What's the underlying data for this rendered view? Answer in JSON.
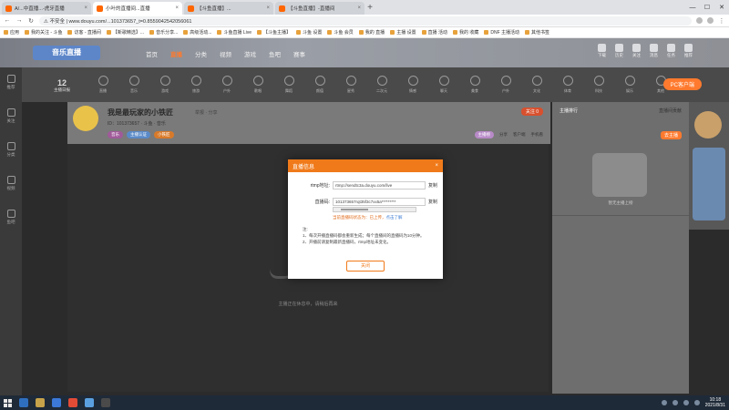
{
  "browser": {
    "tabs": [
      {
        "title": "A/...中直播...-虎牙直播",
        "active": false
      },
      {
        "title": "小叶的直播间...直播",
        "active": true
      },
      {
        "title": "【斗鱼直播】...",
        "active": false
      },
      {
        "title": "【斗鱼直播】-直播间",
        "active": false
      }
    ],
    "url": "⚠ 不安全 | www.douyu.com/...101373657_t=0.8559042542056061",
    "bookmarks": [
      "应用",
      "我的关注 - 斗鱼",
      "访客 - 直播间",
      "【新歌精选】...",
      "音乐分享...",
      "高级活动...",
      "斗鱼直播 Live",
      "【斗鱼主播】",
      "斗鱼 设置",
      "斗鱼 会员",
      "我的 直播",
      "主播 设置",
      "直播 活动",
      "我的 收藏",
      "DNF 主播活动",
      "其他书签"
    ]
  },
  "site": {
    "logo": "音乐直播",
    "nav": [
      {
        "label": "首页",
        "active": false
      },
      {
        "label": "直播",
        "active": true
      },
      {
        "label": "分类",
        "active": false
      },
      {
        "label": "视频",
        "active": false
      },
      {
        "label": "游戏",
        "active": false
      },
      {
        "label": "鱼吧",
        "active": false
      },
      {
        "label": "赛事",
        "active": false
      }
    ],
    "header_icons": [
      "下载",
      "历史",
      "关注",
      "消息",
      "任务",
      "推荐"
    ]
  },
  "sidebar": [
    "推荐",
    "关注",
    "分类",
    "视频",
    "鱼吧"
  ],
  "categories": {
    "day": "12",
    "day_label": "主播日报",
    "items": [
      "直播",
      "音乐",
      "游戏",
      "旅游",
      "户外",
      "歌唱",
      "舞蹈",
      "颜值",
      "星秀",
      "二次元",
      "情感",
      "聊天",
      "美食",
      "户外",
      "文化",
      "体育",
      "科技",
      "娱乐",
      "其他"
    ],
    "pc_button": "PC客户端"
  },
  "room": {
    "title": "我是最玩家的小铁匠",
    "tag": "举报 · 分享",
    "meta": "ID：101373657 · 斗鱼 · 音乐",
    "badges": [
      "音乐",
      "主播认证",
      "小铁匠"
    ],
    "follow": "关注 0",
    "actions": [
      "分享",
      "客户端",
      "手机看"
    ],
    "ms_button": "主播榜"
  },
  "video": {
    "message": "主播正在休息中，请稍后再来"
  },
  "right_panel": {
    "tabs": [
      {
        "label": "主播排行",
        "active": true
      },
      {
        "label": "直播间贡献",
        "active": false
      }
    ],
    "action": "去主播",
    "empty_message": "暂无主播上榜"
  },
  "modal": {
    "title": "直播信息",
    "close_icon": "×",
    "rtmp_label": "rtmp地址:",
    "rtmp_value": "rtmp://sendtc3a.douyu.com/live",
    "key_label": "直播码:",
    "key_value": "101373657rqt35f3c7xx5a*********",
    "copy_label": "复制",
    "hint": "当前直播码状态为：已上传，",
    "hint_link": "点击了解",
    "notes": [
      "注:",
      "1、每次开播直播码都会重新生成；每个直播间的直播码为10分钟。",
      "2、开播前请复制最新直播码，rtmp地址未变化。"
    ],
    "close_button": "关闭"
  },
  "taskbar": {
    "time": "10:18",
    "date": "2021/8/31"
  }
}
